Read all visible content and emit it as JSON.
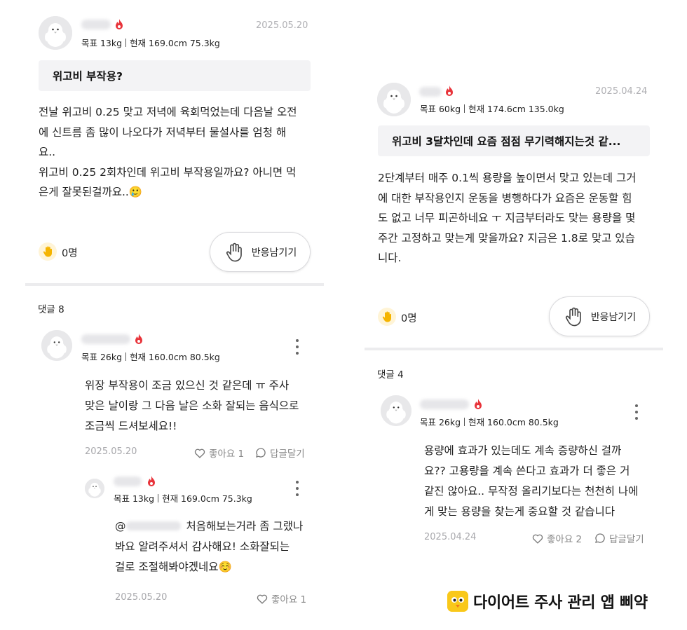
{
  "post_left": {
    "stats": {
      "goal": "목표 13kg",
      "current": "현재 169.0cm  75.3kg"
    },
    "date": "2025.05.20",
    "title": "위고비 부작용?",
    "body": "전날 위고비 0.25 맞고 저녁에 육회먹었는데 다음날 오전\n에 신트름 좀 많이 나오다가 저녁부터 물설사를 엄청 해\n요..\n위고비 0.25 2회차인데 위고비 부작용일까요? 아니면 먹\n은게 잘못된걸까요..🥲",
    "reaction_count": "0명",
    "reaction_button": "반응남기기",
    "comments_label": "댓글 8",
    "comments": [
      {
        "stats": {
          "goal": "목표 26kg",
          "current": "현재 160.0cm  80.5kg"
        },
        "body": "위장 부작용이 조금 있으신 것 같은데 ㅠ 주사\n맞은 날이랑 그 다음 날은 소화 잘되는 음식으로\n조금씩 드셔보세요!!",
        "date": "2025.05.20",
        "like": "좋아요 1",
        "reply": "답글달기"
      }
    ],
    "reply": {
      "stats": {
        "goal": "목표 13kg",
        "current": "현재 169.0cm  75.3kg"
      },
      "mention": "@",
      "body_line1": "처음해보는거라 좀 그랬나",
      "body_rest": "봐요 알려주셔서 감사해요! 소화잘되는\n걸로 조절해봐야겠네요☺️",
      "date": "2025.05.20",
      "like": "좋아요 1"
    }
  },
  "post_right": {
    "stats": {
      "goal": "목표 60kg",
      "current": "현재 174.6cm  135.0kg"
    },
    "date": "2025.04.24",
    "title": "위고비 3달차인데 요즘 점점 무기력해지는것 같...",
    "body": "2단계부터 매주 0.1씩 용량을 높이면서 맞고 있는데 그거\n에 대한 부작용인지 운동을 병행하다가 요즘은 운동할 힘\n도 없고 너무 피곤하네요 ㅜ 지금부터라도 맞는 용량을 몇\n주간 고정하고 맞는게 맞을까요? 지금은 1.8로 맞고 있습\n니다.",
    "reaction_count": "0명",
    "reaction_button": "반응남기기",
    "comments_label": "댓글 4",
    "comments": [
      {
        "stats": {
          "goal": "목표 26kg",
          "current": "현재 160.0cm  80.5kg"
        },
        "body": "용량에 효과가 있는데도 계속 증량하신 걸까\n요?? 고용량을 계속 쓴다고 효과가 더 좋은 거\n같진 않아요.. 무작정 올리기보다는 천천히 나에\n게 맞는 용량을 찾는게 중요할 것 같습니다",
        "date": "2025.04.24",
        "like": "좋아요 2",
        "reply": "답글달기"
      }
    ]
  },
  "brand": {
    "text": "다이어트 주사 관리 앱 삐약"
  },
  "icons": {
    "avatar": "chick-avatar-icon",
    "level": "flame-icon",
    "reaction": "hand-icon",
    "more": "kebab-icon",
    "like": "heart-icon",
    "reply": "speech-bubble-icon"
  },
  "colors": {
    "flame": "#e8333a",
    "brand_yellow": "#f9c81a",
    "title_bg": "#f3f3f5"
  }
}
